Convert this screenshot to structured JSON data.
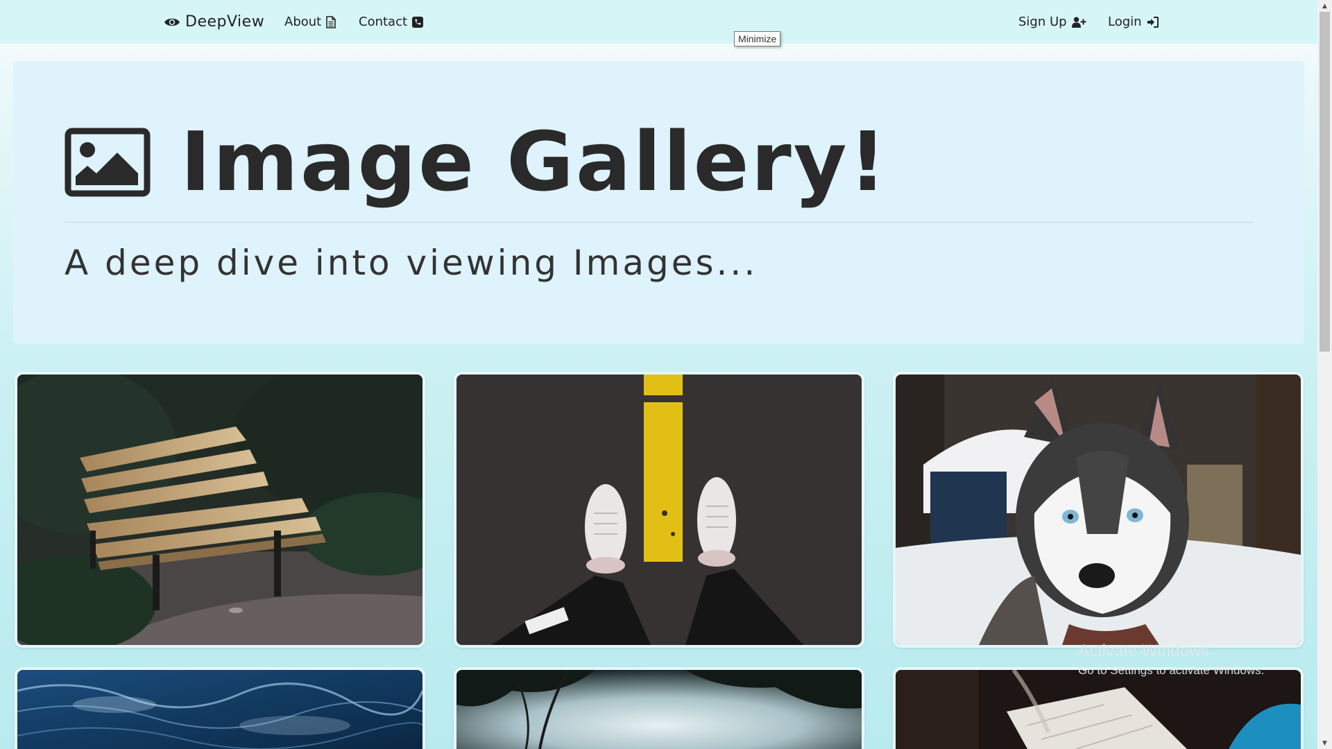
{
  "navbar": {
    "brand": "DeepView",
    "about": "About",
    "contact": "Contact",
    "signup": "Sign Up",
    "login": "Login",
    "tooltip": "Minimize"
  },
  "jumbotron": {
    "title": "Image Gallery!",
    "lead": "A deep dive into viewing Images..."
  },
  "gallery": {
    "images": [
      {
        "subject": "wooden park bench"
      },
      {
        "subject": "sneakers on road yellow line"
      },
      {
        "subject": "husky dog in snow"
      },
      {
        "subject": "ocean waves"
      },
      {
        "subject": "trees against sky"
      },
      {
        "subject": "paper map"
      }
    ]
  },
  "watermark": {
    "title": "Activate Windows",
    "subtitle": "Go to Settings to activate Windows."
  },
  "icons": {
    "brand": "eye-icon",
    "about": "file-text-icon",
    "contact": "phone-square-icon",
    "signup": "user-plus-icon",
    "login": "sign-in-icon",
    "jumbotron": "image-icon"
  }
}
